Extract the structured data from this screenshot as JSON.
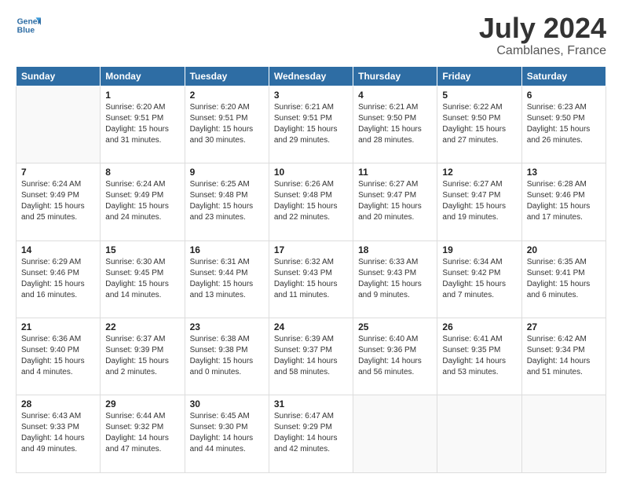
{
  "header": {
    "logo_line1": "General",
    "logo_line2": "Blue",
    "month": "July 2024",
    "location": "Camblanes, France"
  },
  "weekdays": [
    "Sunday",
    "Monday",
    "Tuesday",
    "Wednesday",
    "Thursday",
    "Friday",
    "Saturday"
  ],
  "weeks": [
    [
      {
        "day": "",
        "sunrise": "",
        "sunset": "",
        "daylight": ""
      },
      {
        "day": "1",
        "sunrise": "6:20 AM",
        "sunset": "9:51 PM",
        "daylight": "15 hours and 31 minutes."
      },
      {
        "day": "2",
        "sunrise": "6:20 AM",
        "sunset": "9:51 PM",
        "daylight": "15 hours and 30 minutes."
      },
      {
        "day": "3",
        "sunrise": "6:21 AM",
        "sunset": "9:51 PM",
        "daylight": "15 hours and 29 minutes."
      },
      {
        "day": "4",
        "sunrise": "6:21 AM",
        "sunset": "9:50 PM",
        "daylight": "15 hours and 28 minutes."
      },
      {
        "day": "5",
        "sunrise": "6:22 AM",
        "sunset": "9:50 PM",
        "daylight": "15 hours and 27 minutes."
      },
      {
        "day": "6",
        "sunrise": "6:23 AM",
        "sunset": "9:50 PM",
        "daylight": "15 hours and 26 minutes."
      }
    ],
    [
      {
        "day": "7",
        "sunrise": "6:24 AM",
        "sunset": "9:49 PM",
        "daylight": "15 hours and 25 minutes."
      },
      {
        "day": "8",
        "sunrise": "6:24 AM",
        "sunset": "9:49 PM",
        "daylight": "15 hours and 24 minutes."
      },
      {
        "day": "9",
        "sunrise": "6:25 AM",
        "sunset": "9:48 PM",
        "daylight": "15 hours and 23 minutes."
      },
      {
        "day": "10",
        "sunrise": "6:26 AM",
        "sunset": "9:48 PM",
        "daylight": "15 hours and 22 minutes."
      },
      {
        "day": "11",
        "sunrise": "6:27 AM",
        "sunset": "9:47 PM",
        "daylight": "15 hours and 20 minutes."
      },
      {
        "day": "12",
        "sunrise": "6:27 AM",
        "sunset": "9:47 PM",
        "daylight": "15 hours and 19 minutes."
      },
      {
        "day": "13",
        "sunrise": "6:28 AM",
        "sunset": "9:46 PM",
        "daylight": "15 hours and 17 minutes."
      }
    ],
    [
      {
        "day": "14",
        "sunrise": "6:29 AM",
        "sunset": "9:46 PM",
        "daylight": "15 hours and 16 minutes."
      },
      {
        "day": "15",
        "sunrise": "6:30 AM",
        "sunset": "9:45 PM",
        "daylight": "15 hours and 14 minutes."
      },
      {
        "day": "16",
        "sunrise": "6:31 AM",
        "sunset": "9:44 PM",
        "daylight": "15 hours and 13 minutes."
      },
      {
        "day": "17",
        "sunrise": "6:32 AM",
        "sunset": "9:43 PM",
        "daylight": "15 hours and 11 minutes."
      },
      {
        "day": "18",
        "sunrise": "6:33 AM",
        "sunset": "9:43 PM",
        "daylight": "15 hours and 9 minutes."
      },
      {
        "day": "19",
        "sunrise": "6:34 AM",
        "sunset": "9:42 PM",
        "daylight": "15 hours and 7 minutes."
      },
      {
        "day": "20",
        "sunrise": "6:35 AM",
        "sunset": "9:41 PM",
        "daylight": "15 hours and 6 minutes."
      }
    ],
    [
      {
        "day": "21",
        "sunrise": "6:36 AM",
        "sunset": "9:40 PM",
        "daylight": "15 hours and 4 minutes."
      },
      {
        "day": "22",
        "sunrise": "6:37 AM",
        "sunset": "9:39 PM",
        "daylight": "15 hours and 2 minutes."
      },
      {
        "day": "23",
        "sunrise": "6:38 AM",
        "sunset": "9:38 PM",
        "daylight": "15 hours and 0 minutes."
      },
      {
        "day": "24",
        "sunrise": "6:39 AM",
        "sunset": "9:37 PM",
        "daylight": "14 hours and 58 minutes."
      },
      {
        "day": "25",
        "sunrise": "6:40 AM",
        "sunset": "9:36 PM",
        "daylight": "14 hours and 56 minutes."
      },
      {
        "day": "26",
        "sunrise": "6:41 AM",
        "sunset": "9:35 PM",
        "daylight": "14 hours and 53 minutes."
      },
      {
        "day": "27",
        "sunrise": "6:42 AM",
        "sunset": "9:34 PM",
        "daylight": "14 hours and 51 minutes."
      }
    ],
    [
      {
        "day": "28",
        "sunrise": "6:43 AM",
        "sunset": "9:33 PM",
        "daylight": "14 hours and 49 minutes."
      },
      {
        "day": "29",
        "sunrise": "6:44 AM",
        "sunset": "9:32 PM",
        "daylight": "14 hours and 47 minutes."
      },
      {
        "day": "30",
        "sunrise": "6:45 AM",
        "sunset": "9:30 PM",
        "daylight": "14 hours and 44 minutes."
      },
      {
        "day": "31",
        "sunrise": "6:47 AM",
        "sunset": "9:29 PM",
        "daylight": "14 hours and 42 minutes."
      },
      {
        "day": "",
        "sunrise": "",
        "sunset": "",
        "daylight": ""
      },
      {
        "day": "",
        "sunrise": "",
        "sunset": "",
        "daylight": ""
      },
      {
        "day": "",
        "sunrise": "",
        "sunset": "",
        "daylight": ""
      }
    ]
  ]
}
